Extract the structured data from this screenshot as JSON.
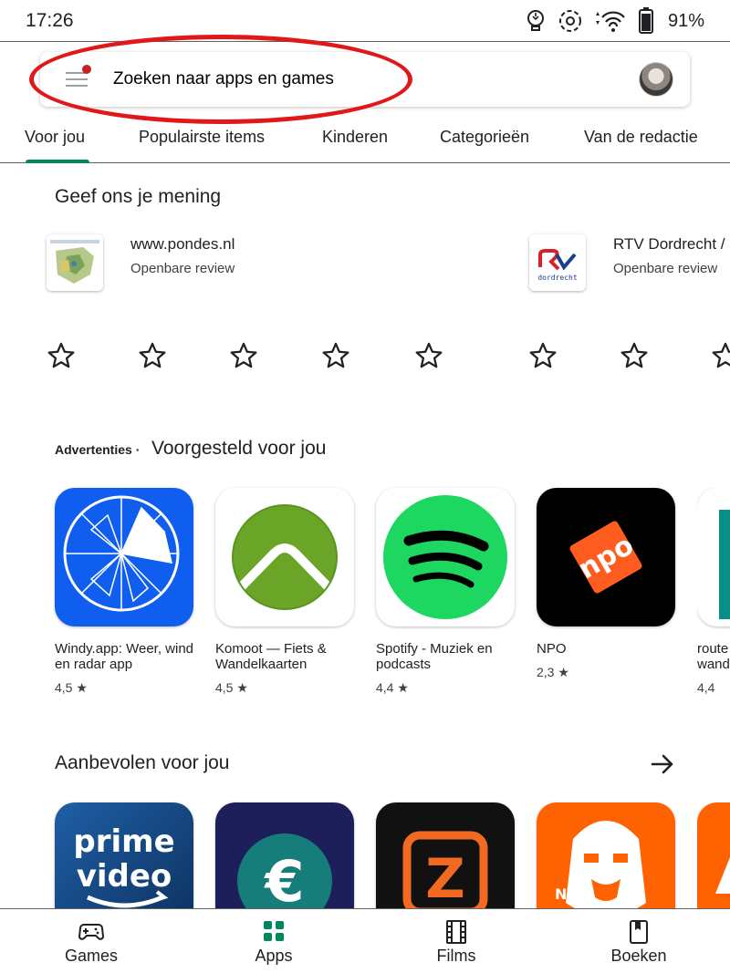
{
  "status_bar": {
    "time": "17:26",
    "battery": "91%"
  },
  "search": {
    "placeholder": "Zoeken naar apps en games"
  },
  "tabs": [
    {
      "label": "Voor jou"
    },
    {
      "label": "Populairste items"
    },
    {
      "label": "Kinderen"
    },
    {
      "label": "Categorieën"
    },
    {
      "label": "Van de redactie"
    }
  ],
  "feedback": {
    "title": "Geef ons je mening",
    "items": [
      {
        "name": "www.pondes.nl",
        "sub": "Openbare review"
      },
      {
        "name": "RTV Dordrecht /",
        "sub": "Openbare review",
        "icon_text": "dordrecht"
      }
    ]
  },
  "suggested": {
    "ads_label": "Advertenties",
    "title": "Voorgesteld voor jou",
    "apps": [
      {
        "name": "Windy.app: Weer, wind en radar app",
        "rating": "4,5 ★",
        "color": "#0f5ef0"
      },
      {
        "name": "Komoot — Fiets & Wandelkaarten",
        "rating": "4,5 ★",
        "color": "#6aa527"
      },
      {
        "name": "Spotify - Muziek en podcasts",
        "rating": "4,4 ★",
        "color": "#1ed760"
      },
      {
        "name": "NPO",
        "rating": "2,3 ★",
        "color": "#ff5d1f"
      },
      {
        "name": "route wand",
        "rating": "4,4",
        "color": "#0a8f88"
      }
    ]
  },
  "recommended": {
    "title": "Aanbevolen voor jou",
    "apps": [
      {
        "line1": "prime",
        "line2": "video",
        "color": "#1a4d8c"
      },
      {
        "symbol": "€",
        "color": "#1c1f5a"
      },
      {
        "symbol": "Z",
        "color": "#111111"
      },
      {
        "badge": "NL",
        "color": "#ff6200"
      },
      {
        "color": "#ff6200"
      }
    ]
  },
  "bottom_nav": [
    {
      "label": "Games",
      "icon": "gamepad-icon"
    },
    {
      "label": "Apps",
      "icon": "apps-grid-icon",
      "active_color": "#01875f"
    },
    {
      "label": "Films",
      "icon": "film-icon"
    },
    {
      "label": "Boeken",
      "icon": "book-icon"
    }
  ]
}
